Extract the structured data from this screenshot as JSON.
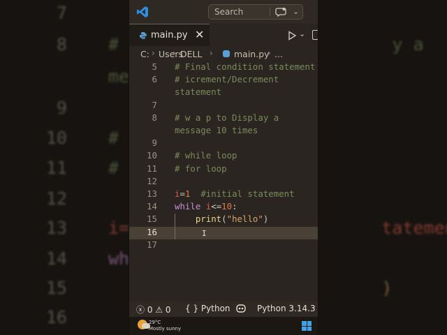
{
  "colors": {
    "comment": "#7a8c5a",
    "keyword": "#c98bd4",
    "variable": "#e05a4a",
    "string": "#d6a36a",
    "number": "#e07a4a",
    "text": "#d0c8bb",
    "accent_vscode": "#2e8fe0"
  },
  "background": {
    "rows": [
      {
        "num": "7",
        "text": ""
      },
      {
        "num": "8",
        "text": "#                          y a"
      },
      {
        "num": "",
        "text": "me"
      },
      {
        "num": "9",
        "text": ""
      },
      {
        "num": "10",
        "text": "#"
      },
      {
        "num": "11",
        "text": "#"
      },
      {
        "num": "12",
        "text": ""
      },
      {
        "num": "13",
        "text": "i=                        tatement"
      },
      {
        "num": "14",
        "text": "wh"
      },
      {
        "num": "15",
        "text": "                          )"
      },
      {
        "num": "16",
        "text": ""
      }
    ]
  },
  "titlebar": {
    "search_label": "Search",
    "app_icon": "vscode-icon",
    "copilot_icon": "copilot-icon"
  },
  "tab": {
    "label": "main.py",
    "close": "✕"
  },
  "breadcrumb": [
    "C:",
    "Users",
    "DELL",
    "main.py",
    "..."
  ],
  "editor": {
    "lines": [
      {
        "num": "5",
        "text": "# Final condition statement",
        "kind": "comment"
      },
      {
        "num": "6",
        "text": "# icrement/Decrement",
        "kind": "comment"
      },
      {
        "num": "",
        "text": "statement",
        "kind": "comment"
      },
      {
        "num": "7",
        "text": "",
        "kind": "plain"
      },
      {
        "num": "8",
        "text": "# w a p to Display a",
        "kind": "comment"
      },
      {
        "num": "",
        "text": "message 10 times",
        "kind": "comment"
      },
      {
        "num": "9",
        "text": "",
        "kind": "plain"
      },
      {
        "num": "10",
        "text": "# while loop",
        "kind": "comment"
      },
      {
        "num": "11",
        "text": "# for loop",
        "kind": "comment"
      },
      {
        "num": "12",
        "text": "",
        "kind": "plain"
      },
      {
        "num": "13",
        "text": "i=1  #initial statement",
        "kind": "assign"
      },
      {
        "num": "14",
        "text": "while i<=10:",
        "kind": "while"
      },
      {
        "num": "15",
        "text": "    print(\"hello\")",
        "kind": "print"
      },
      {
        "num": "16",
        "text": "",
        "kind": "current"
      },
      {
        "num": "17",
        "text": "",
        "kind": "plain"
      }
    ]
  },
  "statusbar": {
    "errors": "0",
    "warnings": "0",
    "language_braces": "{ }",
    "language": "Python",
    "interpreter": "Python 3.14.3"
  },
  "taskbar": {
    "temperature": "29°C",
    "condition": "Mostly sunny"
  }
}
